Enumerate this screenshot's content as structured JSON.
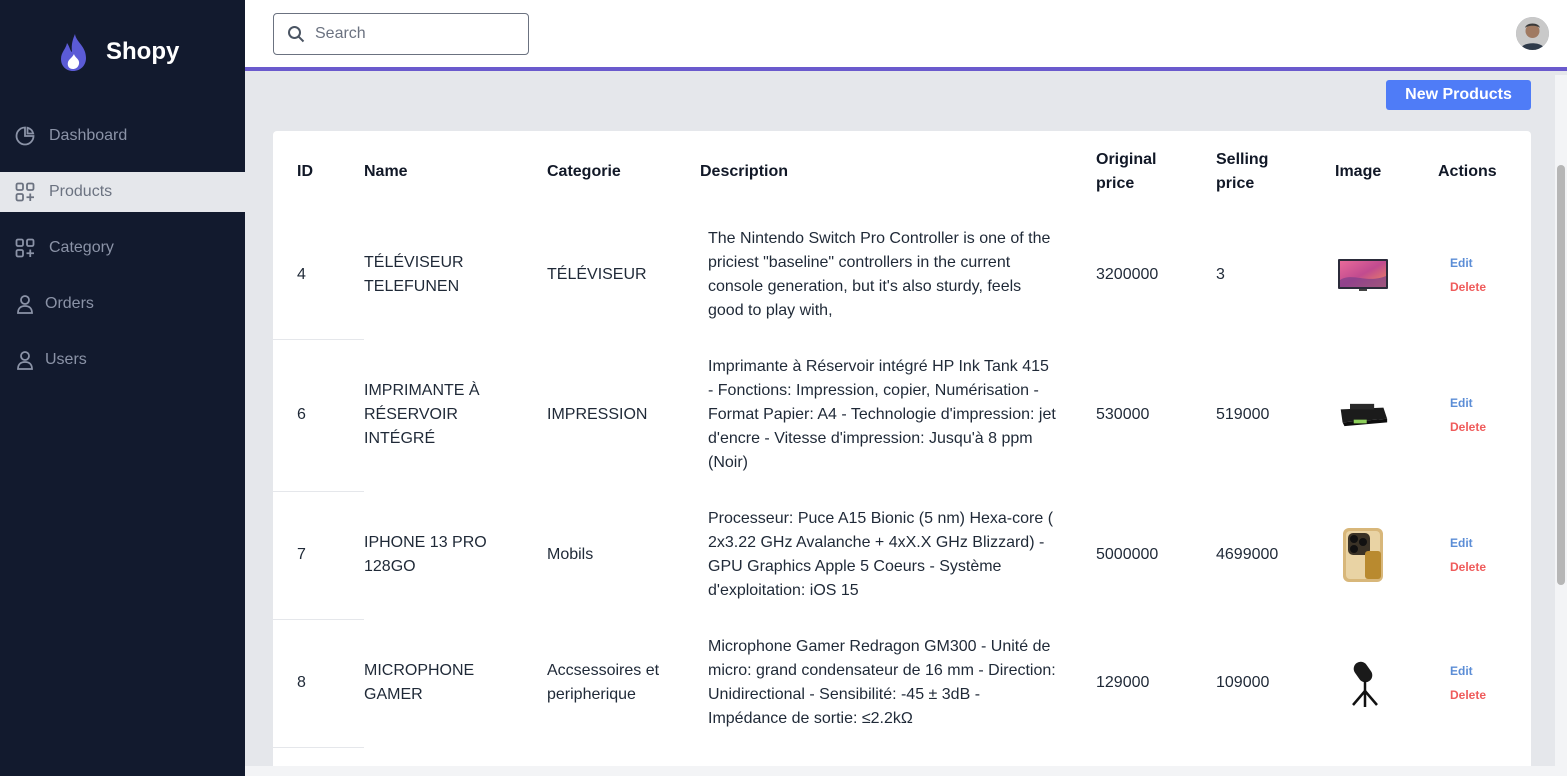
{
  "brand": {
    "name": "Shopy",
    "accent": "#6a5acd"
  },
  "sidebar": {
    "items": [
      {
        "label": "Dashboard",
        "icon": "pie-chart-icon"
      },
      {
        "label": "Products",
        "icon": "grid-plus-icon",
        "active": true
      },
      {
        "label": "Category",
        "icon": "grid-plus-icon"
      },
      {
        "label": "Orders",
        "icon": "user-icon"
      },
      {
        "label": "Users",
        "icon": "user-icon"
      }
    ]
  },
  "header": {
    "search_placeholder": "Search"
  },
  "toolbar": {
    "new_label": "New Products"
  },
  "table": {
    "columns": [
      "ID",
      "Name",
      "Categorie",
      "Description",
      "Original price",
      "Selling price",
      "Image",
      "Actions"
    ],
    "rows": [
      {
        "id": "4",
        "name": "TÉLÉVISEUR TELEFUNEN",
        "category": "TÉLÉVISEUR",
        "description": "The Nintendo Switch Pro Controller is one of the priciest \"baseline\" controllers in the current console generation, but it's also sturdy, feels good to play with,",
        "original_price": "3200000",
        "selling_price": "3",
        "image": "tv-icon"
      },
      {
        "id": "6",
        "name": "IMPRIMANTE À RÉSERVOIR INTÉGRÉ",
        "category": "IMPRESSION",
        "description": "Imprimante à Réservoir intégré HP Ink Tank 415 - Fonctions: Impression, copier, Numérisation - Format Papier: A4 - Technologie d'impression: jet d'encre - Vitesse d'impression: Jusqu'à 8 ppm (Noir)",
        "original_price": "530000",
        "selling_price": "519000",
        "image": "printer-icon"
      },
      {
        "id": "7",
        "name": "IPHONE 13 PRO 128GO",
        "category": "Mobils",
        "description": "Processeur: Puce A15 Bionic (5 nm) Hexa-core ( 2x3.22 GHz Avalanche + 4xX.X GHz Blizzard) - GPU Graphics Apple 5 Coeurs - Système d'exploitation: iOS 15",
        "original_price": "5000000",
        "selling_price": "4699000",
        "image": "phone-icon"
      },
      {
        "id": "8",
        "name": "MICROPHONE GAMER",
        "category": "Accsessoires et peripherique",
        "description": "Microphone Gamer Redragon GM300 - Unité de micro: grand condensateur de 16 mm - Direction: Unidirectional - Sensibilité: -45 ± 3dB - Impédance de sortie: ≤2.2kΩ",
        "original_price": "129000",
        "selling_price": "109000",
        "image": "microphone-icon"
      }
    ],
    "edit_label": "Edit",
    "delete_label": "Delete"
  }
}
